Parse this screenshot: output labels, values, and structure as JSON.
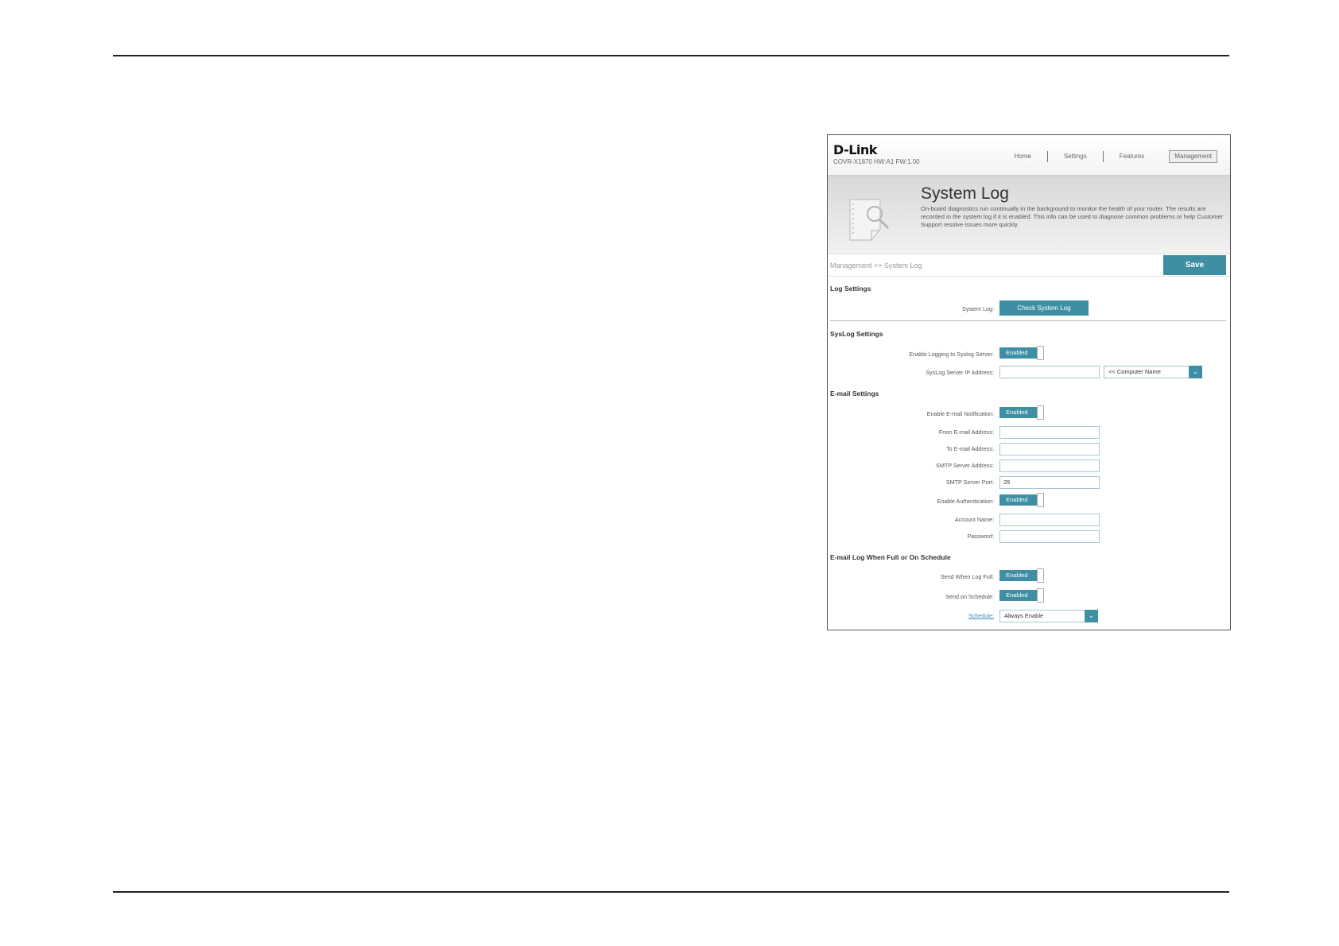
{
  "header": {
    "logo": "D-Link",
    "model": "COVR-X1870 HW:A1 FW:1.00",
    "nav": [
      "Home",
      "Settings",
      "Features",
      "Management"
    ],
    "active_nav": "Management"
  },
  "banner": {
    "title": "System Log",
    "description": "On-board diagnostics run continually in the background to monitor the health of your router. The results are recorded in the system log if it is enabled. This info can be used to diagnose common problems or help Customer Support resolve issues more quickly.",
    "icon": "document-magnifier-icon"
  },
  "breadcrumb": "Management >> System Log",
  "save_label": "Save",
  "log_settings": {
    "title": "Log Settings",
    "system_log_label": "System Log:",
    "check_button": "Check System Log"
  },
  "syslog_settings": {
    "title": "SysLog Settings",
    "enable_label": "Enable Logging to Syslog Server:",
    "enable_value": "Enabled",
    "ip_label": "SysLog Server IP Address:",
    "ip_value": "",
    "computer_select": "<< Computer Name"
  },
  "email_settings": {
    "title": "E-mail Settings",
    "enable_label": "Enable E-mail Notification:",
    "enable_value": "Enabled",
    "from_label": "From E-mail Address:",
    "from_value": "",
    "to_label": "To E-mail Address:",
    "to_value": "",
    "smtp_label": "SMTP Server Address:",
    "smtp_value": "",
    "port_label": "SMTP Server Port:",
    "port_value": "25",
    "auth_label": "Enable Authentication:",
    "auth_value": "Enabled",
    "account_label": "Account Name:",
    "account_value": "",
    "password_label": "Password:",
    "password_value": ""
  },
  "email_log": {
    "title": "E-mail Log When Full or On Schedule",
    "full_label": "Send When Log Full:",
    "full_value": "Enabled",
    "schedule_send_label": "Send on Schedule:",
    "schedule_send_value": "Enabled",
    "schedule_label": "Schedule:",
    "schedule_value": "Always Enable"
  },
  "colors": {
    "accent": "#3e8ea4",
    "link": "#3b8fb5"
  }
}
